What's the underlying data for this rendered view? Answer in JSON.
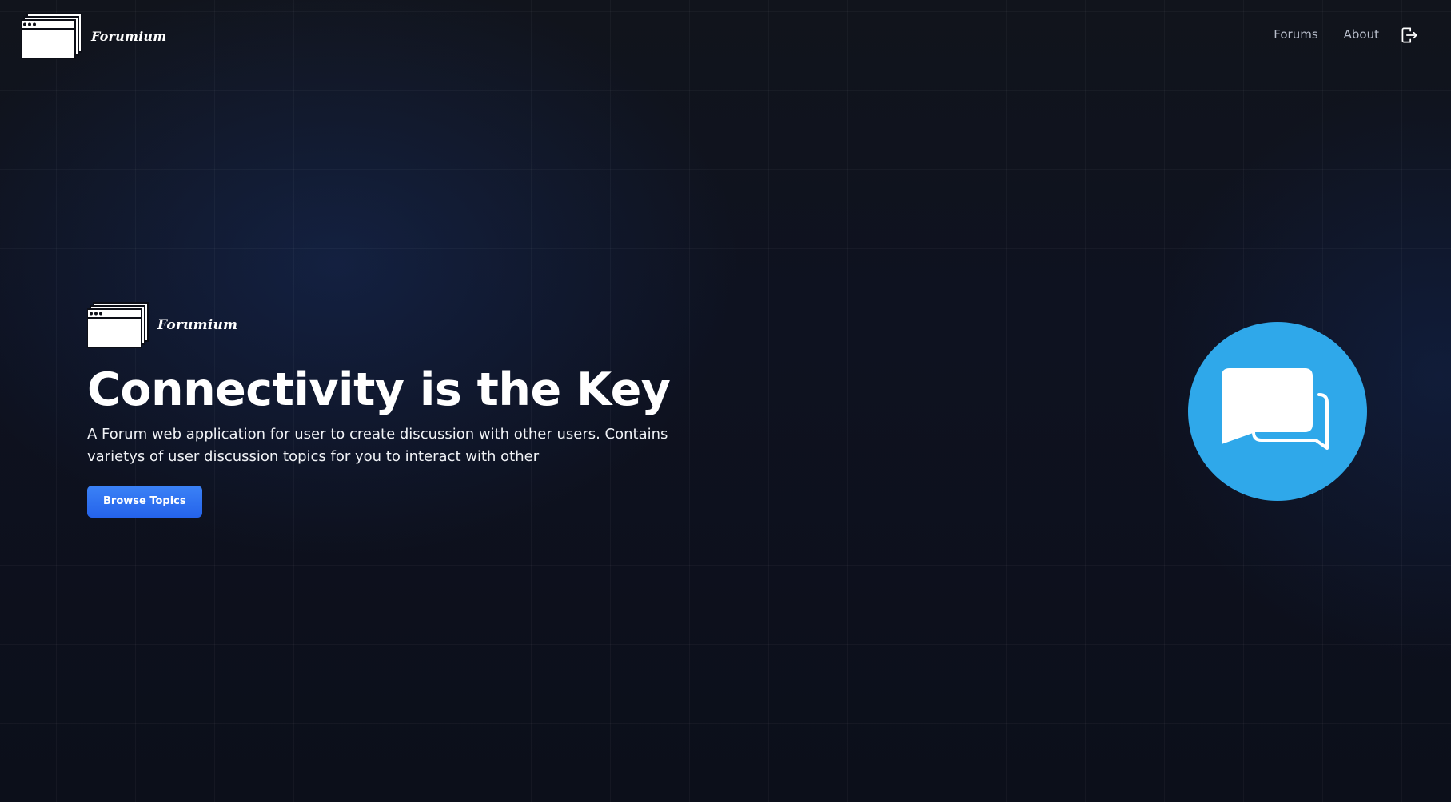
{
  "header": {
    "brand": "Forumium",
    "nav": [
      {
        "label": "Forums"
      },
      {
        "label": "About"
      }
    ],
    "logout_icon": "logout-icon"
  },
  "hero": {
    "brand": "Forumium",
    "title": "Connectivity is the Key",
    "description": "A Forum web application for user to create discussion with other users. Contains varietys of user discussion topics for you to interact with other",
    "button_label": "Browse Topics",
    "illustration_icon": "chat-bubbles-icon"
  },
  "colors": {
    "background": "#0d0f17",
    "accent_button": "#2563eb",
    "illustration_circle": "#2fa8ea",
    "nav_text": "#b9bfcc"
  }
}
